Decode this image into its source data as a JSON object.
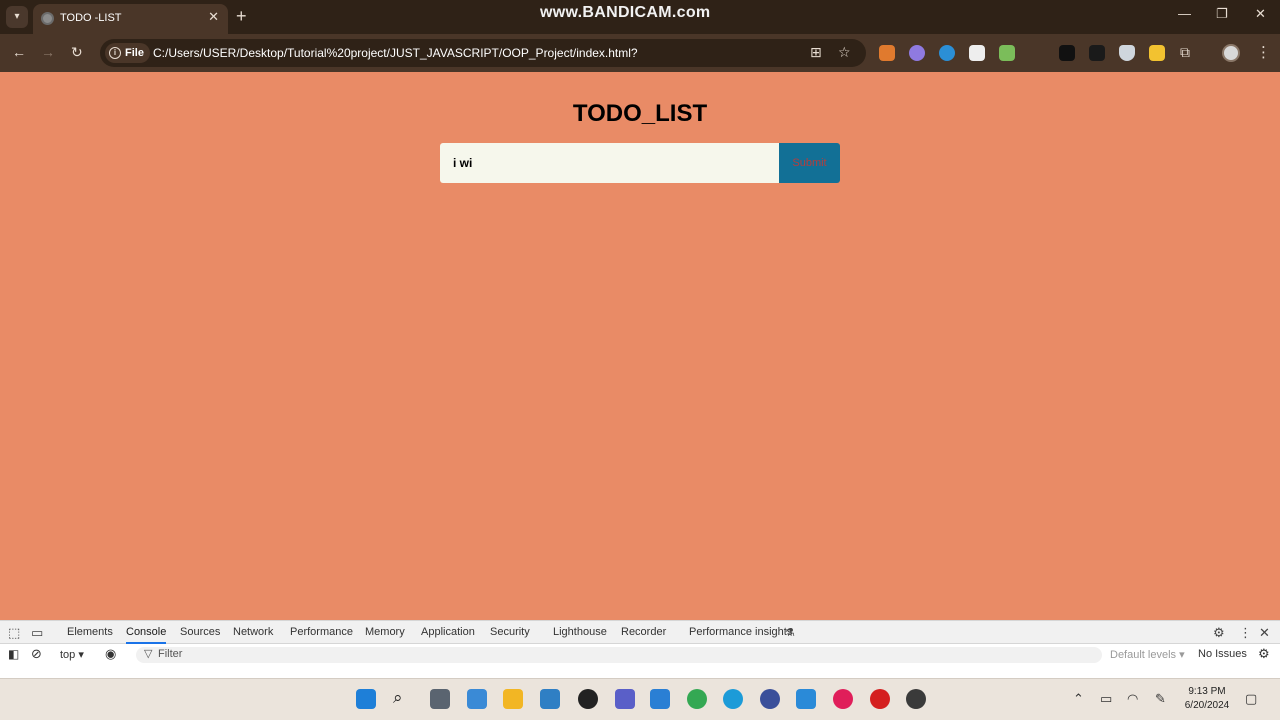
{
  "browser": {
    "tab_title": "TODO -LIST",
    "watermark": "www.BANDICAM.com",
    "site_chip": "File",
    "url": "C:/Users/USER/Desktop/Tutorial%20project/JUST_JAVASCRIPT/OOP_Project/index.html?"
  },
  "page": {
    "title": "TODO_LIST",
    "input_value": "i wi",
    "submit_label": "Submit"
  },
  "devtools": {
    "tabs": [
      "Elements",
      "Console",
      "Sources",
      "Network",
      "Performance",
      "Memory",
      "Application",
      "Security",
      "Lighthouse",
      "Recorder",
      "Performance insights"
    ],
    "active_tab": "Console",
    "context": "top",
    "filter_placeholder": "Filter",
    "levels": "Default levels",
    "issues": "No Issues"
  },
  "taskbar": {
    "time": "9:13 PM",
    "date": "6/20/2024"
  },
  "colors": {
    "page_bg": "#e98b66",
    "input_bg": "#f6f7ec",
    "submit_bg": "#127096",
    "submit_text": "#b53d3d"
  },
  "icons": [
    "tab-search-icon",
    "globe-icon",
    "close-icon",
    "plus-icon",
    "minimize-icon",
    "maximize-icon",
    "back-icon",
    "forward-icon",
    "reload-icon",
    "info-icon",
    "translate-icon",
    "star-icon",
    "extensions-icon",
    "profile-icon",
    "menu-icon",
    "windows-start-icon",
    "search-icon",
    "chrome-icon",
    "vscode-icon"
  ]
}
